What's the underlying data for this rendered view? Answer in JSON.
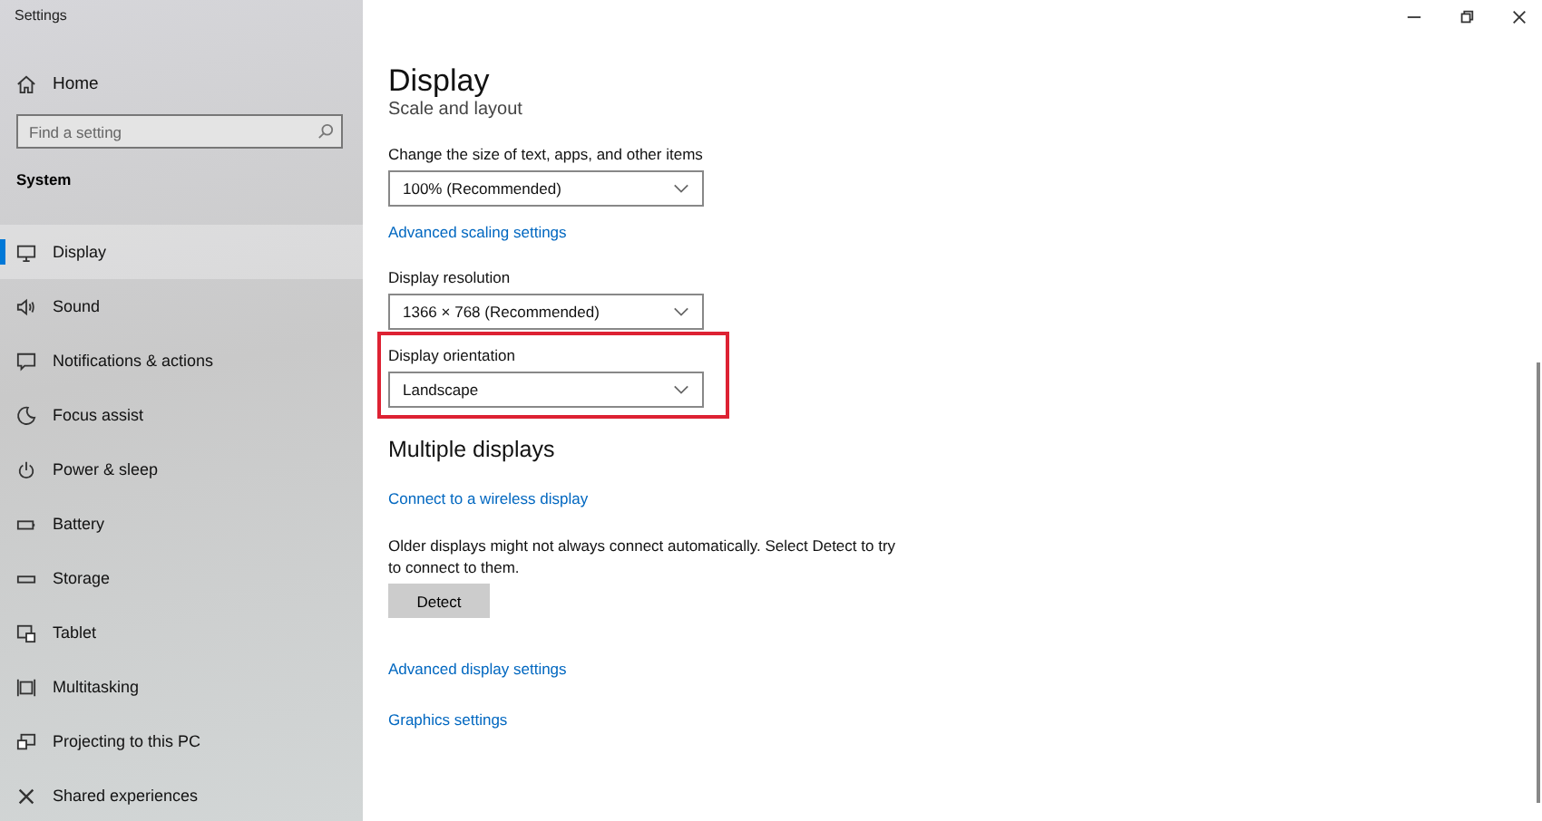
{
  "window": {
    "title": "Settings"
  },
  "sidebar": {
    "home": "Home",
    "search": {
      "placeholder": "Find a setting"
    },
    "section": "System",
    "items": [
      {
        "label": "Display",
        "selected": true
      },
      {
        "label": "Sound",
        "selected": false
      },
      {
        "label": "Notifications & actions",
        "selected": false
      },
      {
        "label": "Focus assist",
        "selected": false
      },
      {
        "label": "Power & sleep",
        "selected": false
      },
      {
        "label": "Battery",
        "selected": false
      },
      {
        "label": "Storage",
        "selected": false
      },
      {
        "label": "Tablet",
        "selected": false
      },
      {
        "label": "Multitasking",
        "selected": false
      },
      {
        "label": "Projecting to this PC",
        "selected": false
      },
      {
        "label": "Shared experiences",
        "selected": false
      }
    ]
  },
  "page": {
    "title": "Display",
    "section": "Scale and layout",
    "content": [
      {
        "kind": "dropdown",
        "label": "Change the size of text, apps, and other items",
        "value": "100% (Recommended)",
        "highlighted": false
      },
      {
        "kind": "link",
        "text": "Advanced scaling settings"
      },
      {
        "kind": "dropdown",
        "label": "Display resolution",
        "value": "1366 × 768 (Recommended)",
        "highlighted": false
      },
      {
        "kind": "dropdown",
        "label": "Display orientation",
        "value": "Landscape",
        "highlighted": true
      },
      {
        "kind": "heading",
        "text": "Multiple displays"
      },
      {
        "kind": "link",
        "text": "Connect to a wireless display"
      },
      {
        "kind": "text",
        "text": "Older displays might not always connect automatically. Select Detect to try to connect to them."
      },
      {
        "kind": "button",
        "text": "Detect"
      },
      {
        "kind": "link",
        "text": "Advanced display settings"
      },
      {
        "kind": "link",
        "text": "Graphics settings"
      }
    ]
  }
}
